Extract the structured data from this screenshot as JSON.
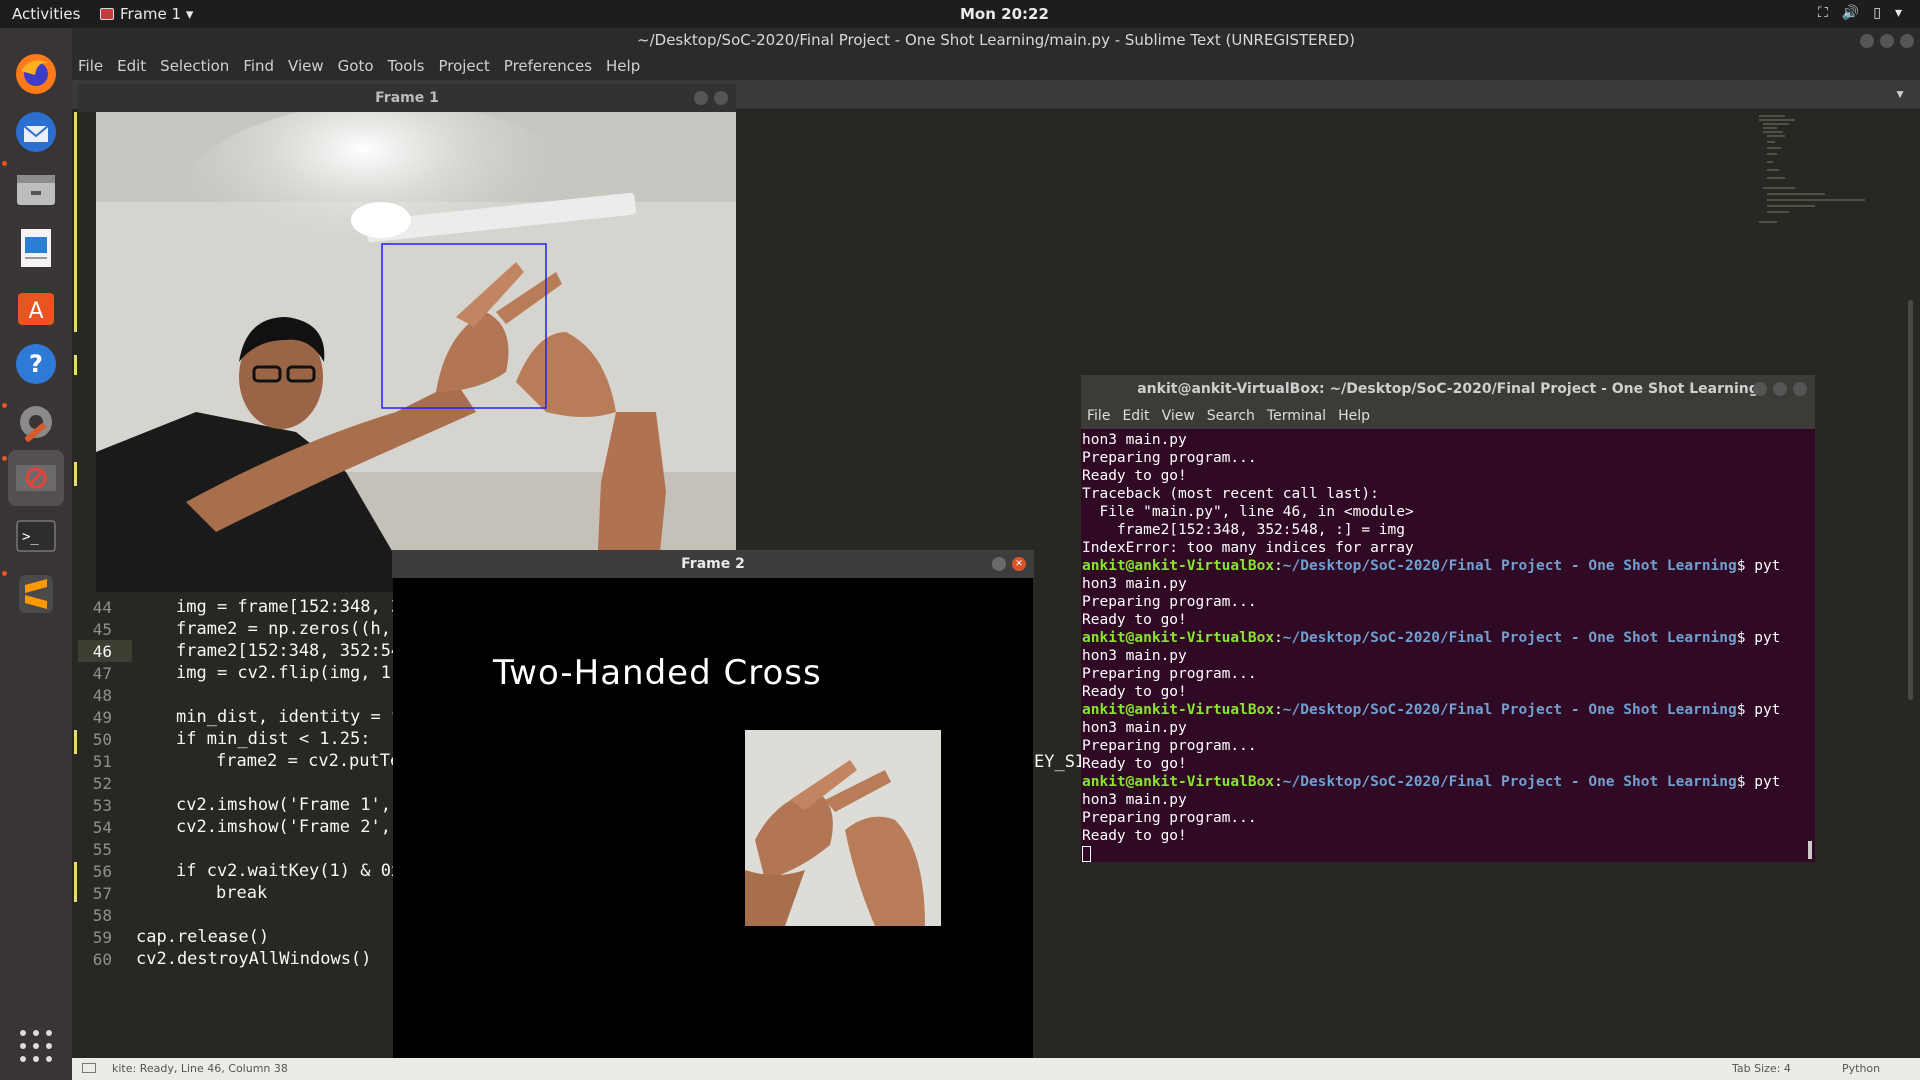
{
  "topbar": {
    "activities": "Activities",
    "app_menu": "Frame 1 ▾",
    "clock": "Mon 20:22"
  },
  "sublime": {
    "title": "~/Desktop/SoC-2020/Final Project - One Shot Learning/main.py - Sublime Text (UNREGISTERED)",
    "menu": [
      "File",
      "Edit",
      "Selection",
      "Find",
      "View",
      "Goto",
      "Tools",
      "Project",
      "Preferences",
      "Help"
    ],
    "code_lines": [
      {
        "n": "44",
        "text": "img = frame[152:348, 3"
      },
      {
        "n": "45",
        "text": "frame2 = np.zeros((h,"
      },
      {
        "n": "46",
        "text": "frame2[152:348, 352:54"
      },
      {
        "n": "47",
        "text": "img = cv2.flip(img, 1)"
      },
      {
        "n": "48",
        "text": ""
      },
      {
        "n": "49",
        "text": "min_dist, identity = f"
      },
      {
        "n": "50",
        "text": "if min_dist < 1.25:"
      },
      {
        "n": "51",
        "text": "frame2 = cv2.putTe"
      },
      {
        "n": "52",
        "text": ""
      },
      {
        "n": "53",
        "text": "cv2.imshow('Frame 1',"
      },
      {
        "n": "54",
        "text": "cv2.imshow('Frame 2',"
      },
      {
        "n": "55",
        "text": ""
      },
      {
        "n": "56",
        "text": "if cv2.waitKey(1) & 0x"
      },
      {
        "n": "57",
        "text": "break"
      },
      {
        "n": "58",
        "text": ""
      },
      {
        "n": "59",
        "text": "cap.release()"
      },
      {
        "n": "60",
        "text": "cv2.destroyAllWindows()"
      }
    ],
    "overflow_text": "EY_SI",
    "status_left": "kite: Ready, Line 46, Column 38",
    "status_tab": "Tab Size: 4",
    "status_syntax": "Python"
  },
  "frame1": {
    "title": "Frame 1"
  },
  "frame2": {
    "title": "Frame 2",
    "label": "Two-Handed Cross"
  },
  "terminal": {
    "title": "ankit@ankit-VirtualBox: ~/Desktop/SoC-2020/Final Project - One Shot Learning",
    "menu": [
      "File",
      "Edit",
      "View",
      "Search",
      "Terminal",
      "Help"
    ],
    "user": "ankit@ankit-VirtualBox",
    "path": "~/Desktop/SoC-2020/Final Project - One Shot Learning",
    "lines": [
      "hon3 main.py",
      "Preparing program...",
      "Ready to go!",
      "Traceback (most recent call last):",
      "  File \"main.py\", line 46, in <module>",
      "    frame2[152:348, 352:548, :] = img",
      "IndexError: too many indices for array",
      "$PROMPT",
      "hon3 main.py",
      "Preparing program...",
      "Ready to go!",
      "$PROMPT",
      "hon3 main.py",
      "Preparing program...",
      "Ready to go!",
      "$PROMPT",
      "hon3 main.py",
      "Preparing program...",
      "Ready to go!",
      "$PROMPT",
      "hon3 main.py",
      "Preparing program...",
      "Ready to go!"
    ],
    "prompt_suffix": "$ pyt"
  },
  "dock_icons": [
    "firefox-icon",
    "thunderbird-icon",
    "files-icon",
    "writer-icon",
    "software-icon",
    "help-icon",
    "settings-icon",
    "frame-app-icon",
    "terminal-icon",
    "sublime-icon",
    "show-apps-icon"
  ]
}
